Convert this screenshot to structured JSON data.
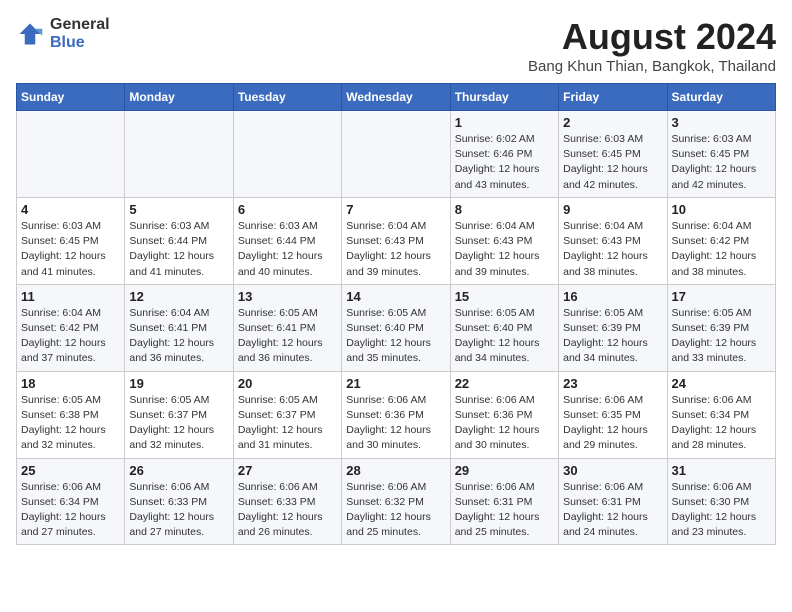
{
  "header": {
    "logo_general": "General",
    "logo_blue": "Blue",
    "title": "August 2024",
    "location": "Bang Khun Thian, Bangkok, Thailand"
  },
  "calendar": {
    "weekdays": [
      "Sunday",
      "Monday",
      "Tuesday",
      "Wednesday",
      "Thursday",
      "Friday",
      "Saturday"
    ],
    "weeks": [
      [
        {
          "day": "",
          "info": ""
        },
        {
          "day": "",
          "info": ""
        },
        {
          "day": "",
          "info": ""
        },
        {
          "day": "",
          "info": ""
        },
        {
          "day": "1",
          "info": "Sunrise: 6:02 AM\nSunset: 6:46 PM\nDaylight: 12 hours\nand 43 minutes."
        },
        {
          "day": "2",
          "info": "Sunrise: 6:03 AM\nSunset: 6:45 PM\nDaylight: 12 hours\nand 42 minutes."
        },
        {
          "day": "3",
          "info": "Sunrise: 6:03 AM\nSunset: 6:45 PM\nDaylight: 12 hours\nand 42 minutes."
        }
      ],
      [
        {
          "day": "4",
          "info": "Sunrise: 6:03 AM\nSunset: 6:45 PM\nDaylight: 12 hours\nand 41 minutes."
        },
        {
          "day": "5",
          "info": "Sunrise: 6:03 AM\nSunset: 6:44 PM\nDaylight: 12 hours\nand 41 minutes."
        },
        {
          "day": "6",
          "info": "Sunrise: 6:03 AM\nSunset: 6:44 PM\nDaylight: 12 hours\nand 40 minutes."
        },
        {
          "day": "7",
          "info": "Sunrise: 6:04 AM\nSunset: 6:43 PM\nDaylight: 12 hours\nand 39 minutes."
        },
        {
          "day": "8",
          "info": "Sunrise: 6:04 AM\nSunset: 6:43 PM\nDaylight: 12 hours\nand 39 minutes."
        },
        {
          "day": "9",
          "info": "Sunrise: 6:04 AM\nSunset: 6:43 PM\nDaylight: 12 hours\nand 38 minutes."
        },
        {
          "day": "10",
          "info": "Sunrise: 6:04 AM\nSunset: 6:42 PM\nDaylight: 12 hours\nand 38 minutes."
        }
      ],
      [
        {
          "day": "11",
          "info": "Sunrise: 6:04 AM\nSunset: 6:42 PM\nDaylight: 12 hours\nand 37 minutes."
        },
        {
          "day": "12",
          "info": "Sunrise: 6:04 AM\nSunset: 6:41 PM\nDaylight: 12 hours\nand 36 minutes."
        },
        {
          "day": "13",
          "info": "Sunrise: 6:05 AM\nSunset: 6:41 PM\nDaylight: 12 hours\nand 36 minutes."
        },
        {
          "day": "14",
          "info": "Sunrise: 6:05 AM\nSunset: 6:40 PM\nDaylight: 12 hours\nand 35 minutes."
        },
        {
          "day": "15",
          "info": "Sunrise: 6:05 AM\nSunset: 6:40 PM\nDaylight: 12 hours\nand 34 minutes."
        },
        {
          "day": "16",
          "info": "Sunrise: 6:05 AM\nSunset: 6:39 PM\nDaylight: 12 hours\nand 34 minutes."
        },
        {
          "day": "17",
          "info": "Sunrise: 6:05 AM\nSunset: 6:39 PM\nDaylight: 12 hours\nand 33 minutes."
        }
      ],
      [
        {
          "day": "18",
          "info": "Sunrise: 6:05 AM\nSunset: 6:38 PM\nDaylight: 12 hours\nand 32 minutes."
        },
        {
          "day": "19",
          "info": "Sunrise: 6:05 AM\nSunset: 6:37 PM\nDaylight: 12 hours\nand 32 minutes."
        },
        {
          "day": "20",
          "info": "Sunrise: 6:05 AM\nSunset: 6:37 PM\nDaylight: 12 hours\nand 31 minutes."
        },
        {
          "day": "21",
          "info": "Sunrise: 6:06 AM\nSunset: 6:36 PM\nDaylight: 12 hours\nand 30 minutes."
        },
        {
          "day": "22",
          "info": "Sunrise: 6:06 AM\nSunset: 6:36 PM\nDaylight: 12 hours\nand 30 minutes."
        },
        {
          "day": "23",
          "info": "Sunrise: 6:06 AM\nSunset: 6:35 PM\nDaylight: 12 hours\nand 29 minutes."
        },
        {
          "day": "24",
          "info": "Sunrise: 6:06 AM\nSunset: 6:34 PM\nDaylight: 12 hours\nand 28 minutes."
        }
      ],
      [
        {
          "day": "25",
          "info": "Sunrise: 6:06 AM\nSunset: 6:34 PM\nDaylight: 12 hours\nand 27 minutes."
        },
        {
          "day": "26",
          "info": "Sunrise: 6:06 AM\nSunset: 6:33 PM\nDaylight: 12 hours\nand 27 minutes."
        },
        {
          "day": "27",
          "info": "Sunrise: 6:06 AM\nSunset: 6:33 PM\nDaylight: 12 hours\nand 26 minutes."
        },
        {
          "day": "28",
          "info": "Sunrise: 6:06 AM\nSunset: 6:32 PM\nDaylight: 12 hours\nand 25 minutes."
        },
        {
          "day": "29",
          "info": "Sunrise: 6:06 AM\nSunset: 6:31 PM\nDaylight: 12 hours\nand 25 minutes."
        },
        {
          "day": "30",
          "info": "Sunrise: 6:06 AM\nSunset: 6:31 PM\nDaylight: 12 hours\nand 24 minutes."
        },
        {
          "day": "31",
          "info": "Sunrise: 6:06 AM\nSunset: 6:30 PM\nDaylight: 12 hours\nand 23 minutes."
        }
      ]
    ]
  }
}
